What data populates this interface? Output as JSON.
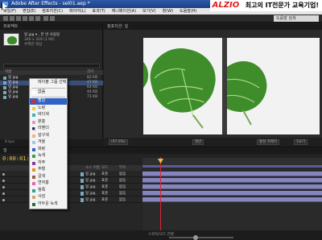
{
  "window": {
    "title": "Adobe After Effects - sel01.aep *"
  },
  "menu": [
    "파일(F)",
    "편집(E)",
    "컴포지션(C)",
    "레이어(L)",
    "효과(T)",
    "애니메이션(A)",
    "보기(V)",
    "창(W)",
    "도움말(H)"
  ],
  "brand": {
    "logo": "ALZIO",
    "tagline": "최고의 IT전문가 교육기업!"
  },
  "help_search": {
    "placeholder": "도움말 검색"
  },
  "project_panel": {
    "tab": "프로젝트",
    "item_name": "잎.jpg",
    "info_line1": "잎.jpg ▾ , 한 번 사용됨",
    "info_line2": "346 x 329 (1.00)",
    "info_line3": "수백만 색상",
    "columns": [
      "이름",
      "크기"
    ],
    "files": [
      {
        "name": "잎.jpg",
        "size": "82 KB",
        "selected": false
      },
      {
        "name": "잎.jpg",
        "size": "47 KB",
        "selected": true
      },
      {
        "name": "잎.jpg",
        "size": "64 KB",
        "selected": false
      },
      {
        "name": "잎.jpg",
        "size": "44 KB",
        "selected": false
      },
      {
        "name": "잎.jpg",
        "size": "71 KB",
        "selected": false
      }
    ],
    "footer": "8 bpc"
  },
  "context_menu": {
    "items": [
      {
        "label": "레이블 그룹 선택",
        "swatch": null,
        "bullet": false,
        "highlighted": false
      },
      {
        "label": "없음",
        "swatch": "#ffffff",
        "bullet": false,
        "highlighted": false
      },
      {
        "label": "빨강",
        "swatch": "#c83232",
        "bullet": false,
        "highlighted": true
      },
      {
        "label": "노랑",
        "swatch": "#e6d23c",
        "bullet": false,
        "highlighted": false
      },
      {
        "label": "바다색",
        "swatch": "#3cb4b4",
        "bullet": false,
        "highlighted": false
      },
      {
        "label": "분홍",
        "swatch": "#e696c8",
        "bullet": false,
        "highlighted": false
      },
      {
        "label": "라벤더",
        "swatch": "#aa96e6",
        "bullet": true,
        "highlighted": false
      },
      {
        "label": "살구색",
        "swatch": "#f0b48c",
        "bullet": false,
        "highlighted": false
      },
      {
        "label": "겨울",
        "swatch": "#a0c8e6",
        "bullet": false,
        "highlighted": false
      },
      {
        "label": "파랑",
        "swatch": "#3264c8",
        "bullet": false,
        "highlighted": false
      },
      {
        "label": "녹색",
        "swatch": "#3ca03c",
        "bullet": false,
        "highlighted": false
      },
      {
        "label": "자주",
        "swatch": "#8c3ca0",
        "bullet": false,
        "highlighted": false
      },
      {
        "label": "주황",
        "swatch": "#e68c32",
        "bullet": false,
        "highlighted": false
      },
      {
        "label": "갈색",
        "swatch": "#8c643c",
        "bullet": false,
        "highlighted": false
      },
      {
        "label": "연자홍",
        "swatch": "#e664b4",
        "bullet": false,
        "highlighted": false
      },
      {
        "label": "청록",
        "swatch": "#32a0a0",
        "bullet": false,
        "highlighted": false
      },
      {
        "label": "사암",
        "swatch": "#c8aa78",
        "bullet": false,
        "highlighted": false
      },
      {
        "label": "어두운 녹색",
        "swatch": "#2d6e32",
        "bullet": false,
        "highlighted": false
      }
    ]
  },
  "composition_panel": {
    "tab": "컴포지션: 잎",
    "footer": {
      "zoom": "(97.9%)",
      "resolution": "절반",
      "view": "활성 카메라",
      "views": "1보기"
    }
  },
  "timeline": {
    "tab": "잎",
    "timecode": "0:00:01:04",
    "columns": [
      "소스 이름",
      "모드",
      "부모"
    ],
    "layers": [
      {
        "name": "잎.jpg",
        "mode": "표준",
        "parent": "없음"
      },
      {
        "name": "잎.jpg",
        "mode": "표준",
        "parent": "없음"
      },
      {
        "name": "잎.jpg",
        "mode": "표준",
        "parent": "없음"
      },
      {
        "name": "잎.jpg",
        "mode": "표준",
        "parent": "없음"
      },
      {
        "name": "잎.jpg",
        "mode": "표준",
        "parent": "없음"
      }
    ],
    "footer": "스위치/모드 전환"
  }
}
